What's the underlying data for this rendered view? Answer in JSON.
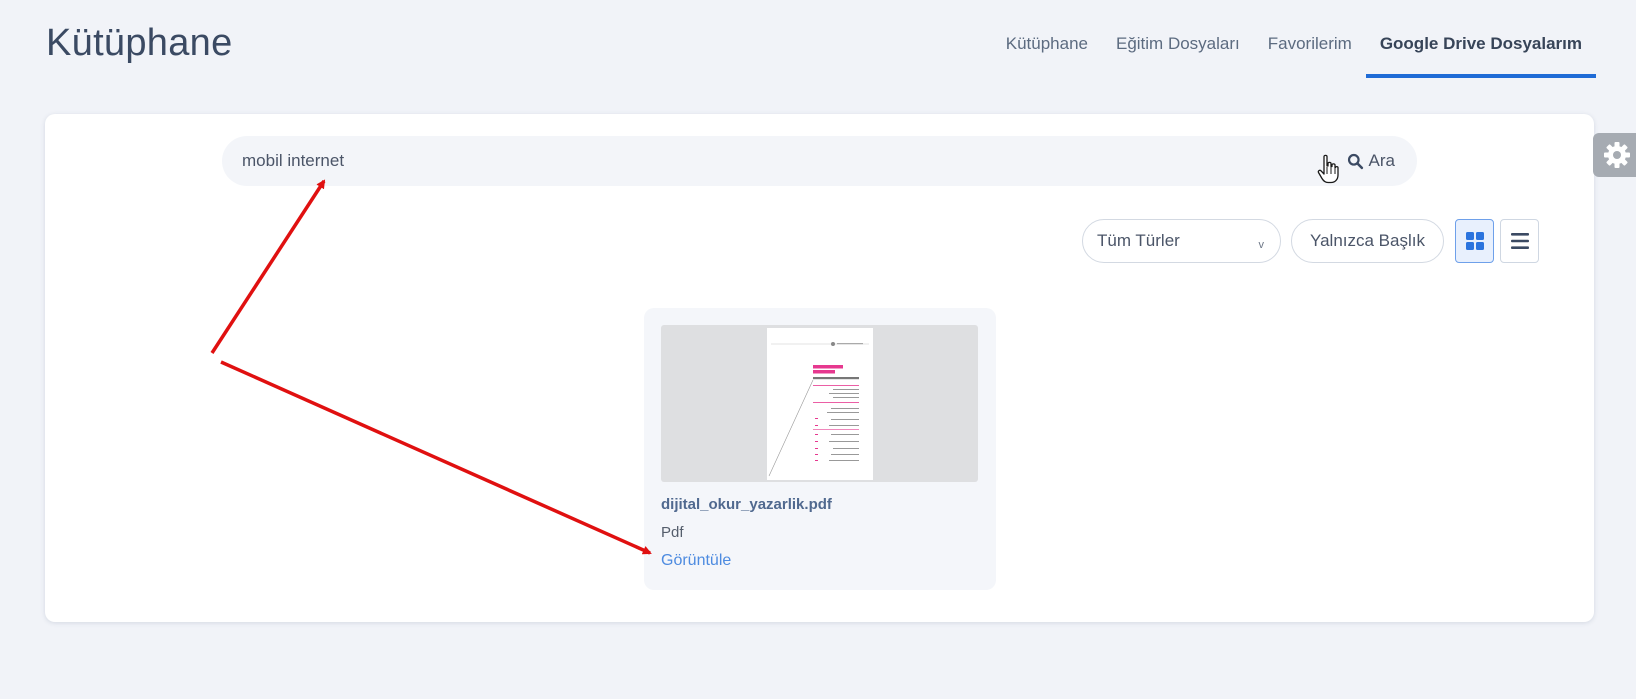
{
  "page": {
    "title": "Kütüphane"
  },
  "tabs": [
    {
      "label": "Kütüphane",
      "active": false
    },
    {
      "label": "Eğitim Dosyaları",
      "active": false
    },
    {
      "label": "Favorilerim",
      "active": false
    },
    {
      "label": "Google Drive Dosyalarım",
      "active": true
    }
  ],
  "search": {
    "value": "mobil internet",
    "button_label": "Ara",
    "icon": "search-icon"
  },
  "filters": {
    "type_select": {
      "selected": "Tüm Türler",
      "icon": "chevron-down-icon"
    },
    "title_only_label": "Yalnızca Başlık",
    "view_modes": [
      {
        "icon": "grid-view-icon",
        "active": true
      },
      {
        "icon": "list-view-icon",
        "active": false
      }
    ]
  },
  "files": [
    {
      "name": "dijital_okur_yazarlik.pdf",
      "type": "Pdf",
      "action_label": "Görüntüle"
    }
  ],
  "settings": {
    "icon": "gear-icon"
  },
  "colors": {
    "background": "#f1f3f8",
    "accent": "#1f6bd6",
    "link": "#4d8be0",
    "annotation_arrow": "#e01010"
  }
}
